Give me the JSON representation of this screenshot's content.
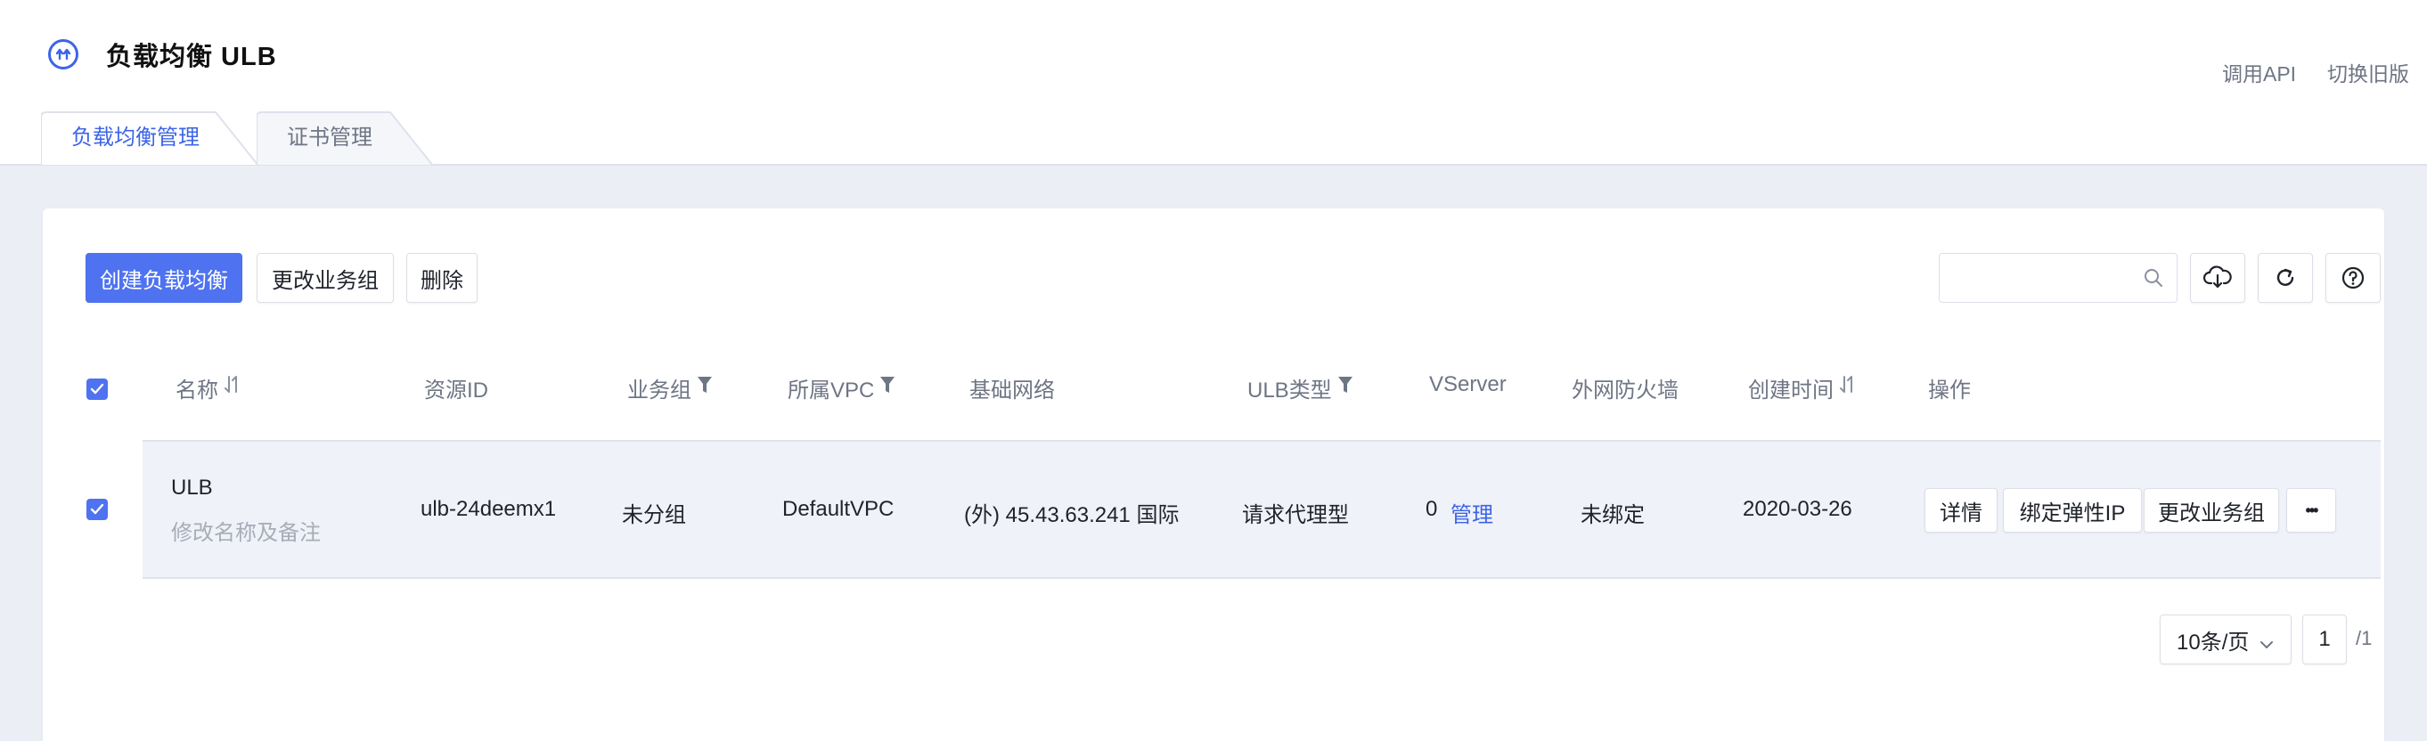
{
  "header": {
    "title": "负载均衡 ULB",
    "links": {
      "api": "调用API",
      "old": "切换旧版"
    }
  },
  "tabs": [
    {
      "label": "负载均衡管理",
      "active": true
    },
    {
      "label": "证书管理",
      "active": false
    }
  ],
  "toolbar": {
    "create": "创建负载均衡",
    "change_group": "更改业务组",
    "delete": "删除",
    "search_placeholder": ""
  },
  "table": {
    "columns": {
      "name": "名称",
      "resource_id": "资源ID",
      "group": "业务组",
      "vpc": "所属VPC",
      "network": "基础网络",
      "ulb_type": "ULB类型",
      "vserver": "VServer",
      "firewall": "外网防火墙",
      "created": "创建时间",
      "actions": "操作"
    },
    "rows": [
      {
        "checked": true,
        "name": "ULB",
        "remark": "修改名称及备注",
        "resource_id": "ulb-24deemx1",
        "group": "未分组",
        "vpc": "DefaultVPC",
        "network": "(外) 45.43.63.241 国际",
        "ulb_type": "请求代理型",
        "vserver_count": "0",
        "vserver_manage": "管理",
        "firewall": "未绑定",
        "created": "2020-03-26",
        "actions": {
          "detail": "详情",
          "bind_eip": "绑定弹性IP",
          "change_group": "更改业务组",
          "more": "•••"
        }
      }
    ]
  },
  "pagination": {
    "page_size": "10条/页",
    "current_page": "1",
    "total_pages": "/1"
  },
  "colors": {
    "accent": "#4e72f0",
    "link": "#3d64e8",
    "row_bg": "#f0f2fa",
    "page_bg": "#eceef6"
  }
}
